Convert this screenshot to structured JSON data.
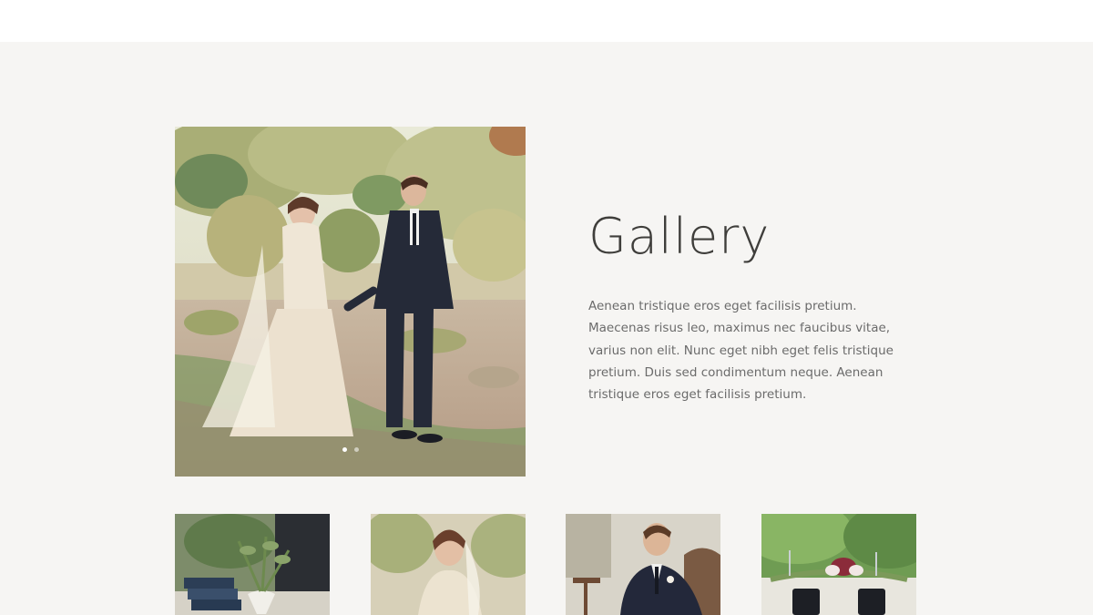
{
  "gallery": {
    "title": "Gallery",
    "description": "Aenean tristique eros eget facilisis pretium. Maecenas risus leo, maximus nec faucibus vitae, varius non elit. Nunc eget nibh eget felis tristique pretium. Duis sed condimentum neque. Aenean tristique eros eget facilisis pretium.",
    "slider": {
      "slide_count": 2,
      "active_slide": 1
    },
    "thumbnails": [
      {
        "subject": "table-decor"
      },
      {
        "subject": "bride-portrait"
      },
      {
        "subject": "groom-portrait"
      },
      {
        "subject": "reception-table"
      }
    ]
  }
}
